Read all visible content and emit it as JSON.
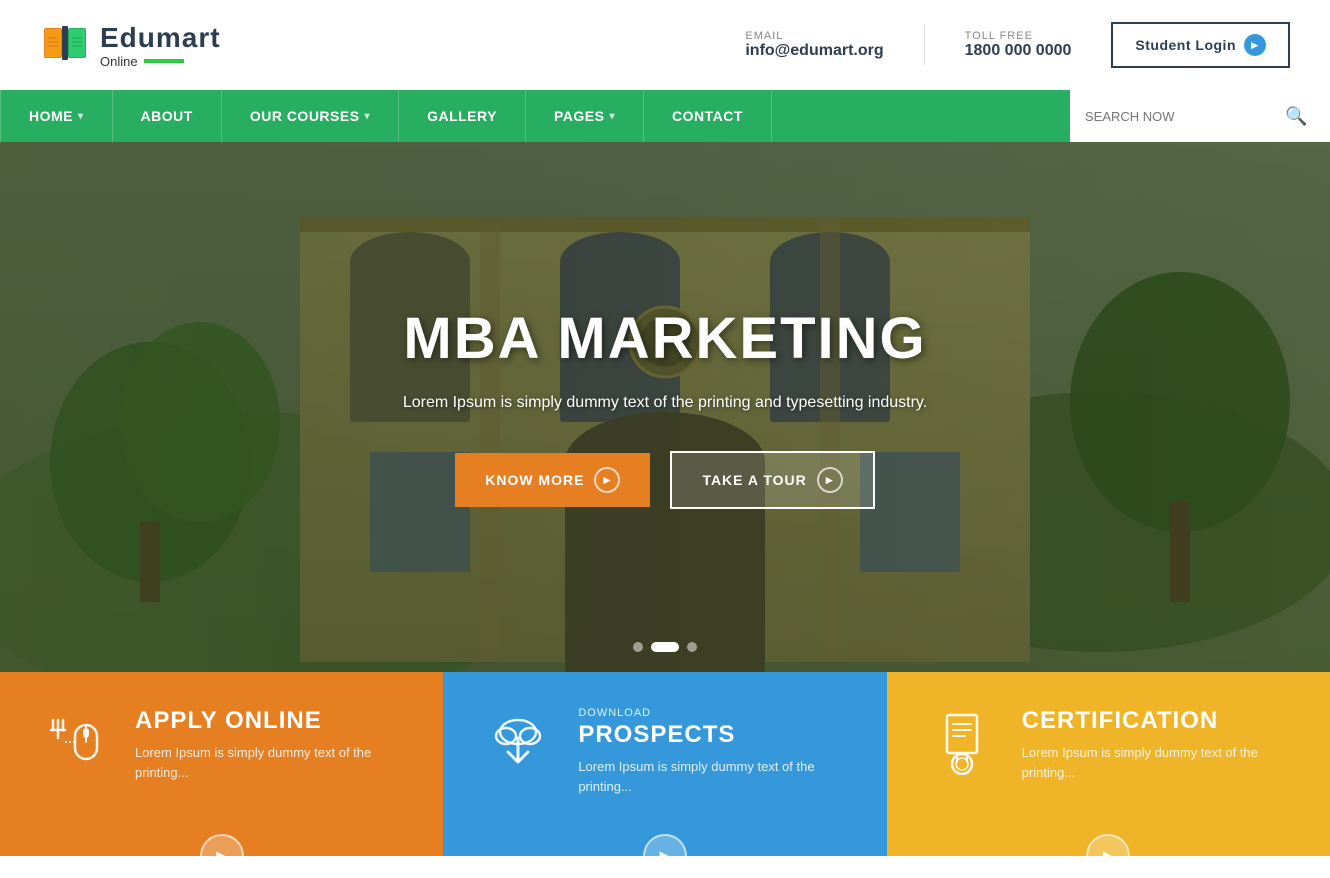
{
  "header": {
    "logo_title": "Edumart",
    "logo_subtitle": "Online",
    "email_label": "EMAIL",
    "email_value": "info@edumart.org",
    "phone_label": "TOLL FREE",
    "phone_value": "1800 000 0000",
    "login_button": "Student Login"
  },
  "nav": {
    "items": [
      {
        "label": "HOME",
        "has_dropdown": true
      },
      {
        "label": "ABOUT",
        "has_dropdown": false
      },
      {
        "label": "OUR COURSES",
        "has_dropdown": true
      },
      {
        "label": "GALLERY",
        "has_dropdown": false
      },
      {
        "label": "PAGES",
        "has_dropdown": true
      },
      {
        "label": "CONTACT",
        "has_dropdown": false
      }
    ],
    "search_placeholder": "SEARCH NOW"
  },
  "hero": {
    "title": "MBA MARKETING",
    "subtitle": "Lorem Ipsum is simply dummy text of the printing and typesetting industry.",
    "btn_know_more": "KNOW MORE",
    "btn_take_tour": "TAKE A TOUR",
    "dots": [
      {
        "active": false
      },
      {
        "active": true
      },
      {
        "active": false
      }
    ]
  },
  "cards": [
    {
      "id": "apply",
      "bg": "orange",
      "label": "",
      "title": "APPLY ONLINE",
      "desc": "Lorem Ipsum is simply dummy text of the printing..."
    },
    {
      "id": "download",
      "bg": "blue",
      "label": "DOWNLOAD",
      "title": "PROSPECTS",
      "desc": "Lorem Ipsum is simply dummy text of the printing..."
    },
    {
      "id": "cert",
      "bg": "yellow",
      "label": "",
      "title": "CERTIFICATION",
      "desc": "Lorem Ipsum is simply dummy text of the printing..."
    }
  ]
}
